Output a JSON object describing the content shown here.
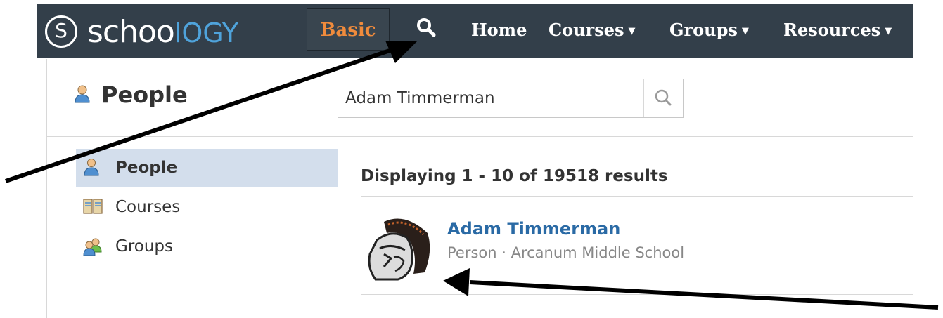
{
  "header": {
    "logo_prefix": "schoo",
    "logo_suffix": "lOGY",
    "logo_letter": "S",
    "basic_label": "Basic",
    "nav_items": [
      {
        "label": "Home",
        "has_caret": false
      },
      {
        "label": "Courses",
        "has_caret": true
      },
      {
        "label": "Groups",
        "has_caret": true
      },
      {
        "label": "Resources",
        "has_caret": true
      }
    ],
    "caret": "▼",
    "search_icon": "search-icon"
  },
  "page": {
    "title": "People",
    "title_icon": "person-icon"
  },
  "search": {
    "value": "Adam Timmerman",
    "button_icon": "search-icon"
  },
  "sidebar": {
    "items": [
      {
        "label": "People",
        "icon": "person-icon",
        "active": true
      },
      {
        "label": "Courses",
        "icon": "book-icon",
        "active": false
      },
      {
        "label": "Groups",
        "icon": "group-icon",
        "active": false
      }
    ]
  },
  "results": {
    "summary": "Displaying 1 - 10 of 19518 results",
    "items": [
      {
        "name": "Adam Timmerman",
        "meta": "Person · Arcanum Middle School",
        "avatar": "spartan-helmet-avatar"
      }
    ]
  },
  "annotations": {
    "arrow_color": "#000000"
  },
  "colors": {
    "topbar": "#333f4a",
    "basic_text": "#f08b3c",
    "logo_accent": "#4fa3db",
    "active_item": "#d3deec",
    "link": "#2a6aa5"
  }
}
